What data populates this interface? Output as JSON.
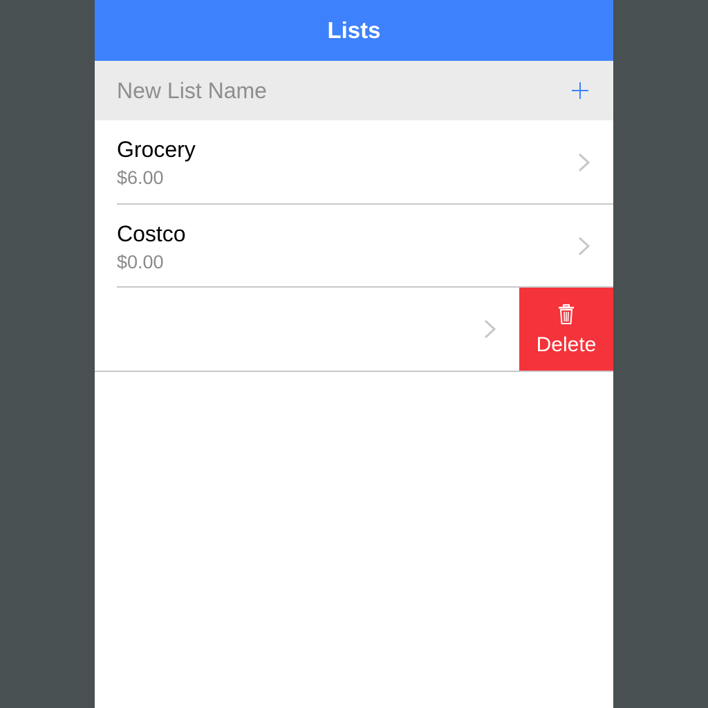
{
  "nav": {
    "title": "Lists"
  },
  "new_list": {
    "placeholder": "New List Name",
    "value": "",
    "add_icon": "plus-icon"
  },
  "lists": [
    {
      "name": "Grocery",
      "total": "$6.00",
      "chevron_icon": "chevron-right-icon"
    },
    {
      "name": "Costco",
      "total": "$0.00",
      "chevron_icon": "chevron-right-icon"
    },
    {
      "name": "",
      "total": "",
      "chevron_icon": "chevron-right-icon",
      "swiped": true
    }
  ],
  "swipe_action": {
    "label": "Delete",
    "icon": "trash-icon"
  },
  "colors": {
    "nav_bar": "#3e81fd",
    "delete": "#f5333a",
    "background": "#485052",
    "input_bar": "#ebebeb"
  }
}
